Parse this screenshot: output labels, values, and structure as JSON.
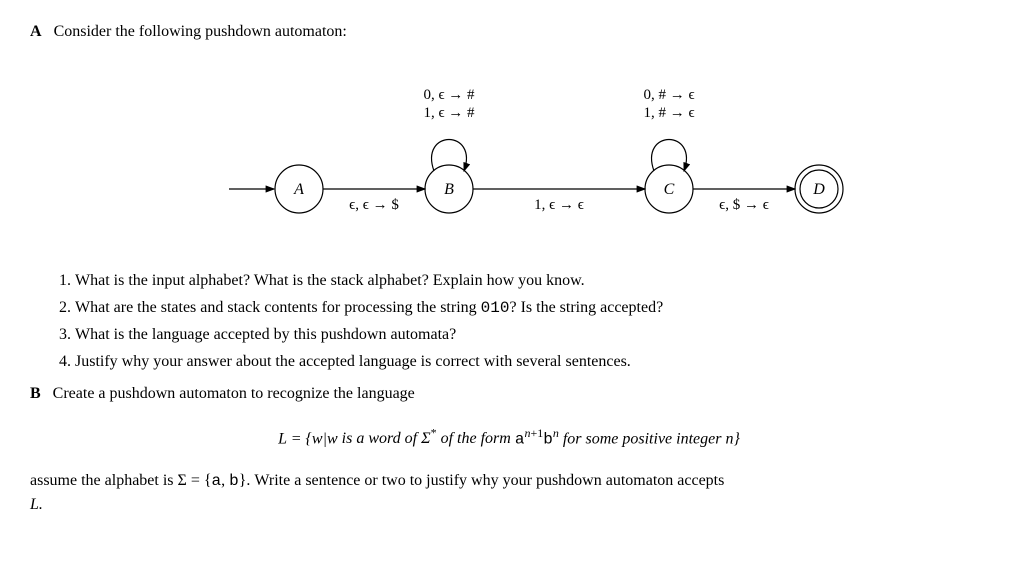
{
  "partA": {
    "label": "A",
    "intro": "Consider the following pushdown automaton:",
    "automaton": {
      "states": {
        "A": "A",
        "B": "B",
        "C": "C",
        "D": "D"
      },
      "transitions": {
        "A_to_B": "ϵ, ϵ → $",
        "B_loop_1": "0, ϵ → #",
        "B_loop_2": "1, ϵ → #",
        "B_to_C": "1, ϵ → ϵ",
        "C_loop_1": "0, # → ϵ",
        "C_loop_2": "1, # → ϵ",
        "C_to_D": "ϵ, $ → ϵ"
      }
    },
    "questions": [
      "What is the input alphabet? What is the stack alphabet? Explain how you know.",
      "What are the states and stack contents for processing the string 010? Is the string accepted?",
      "What is the language accepted by this pushdown automata?",
      "Justify why your answer about the accepted language is correct with several sentences."
    ]
  },
  "partB": {
    "label": "B",
    "intro": "Create a pushdown automaton to recognize the language",
    "language_prefix": "L = {w|w",
    "language_mid1": " is a word of Σ",
    "language_star": "*",
    "language_mid2": " of the form ",
    "language_a": "a",
    "language_exp1_pre": "n",
    "language_exp1_plus": "+1",
    "language_b": "b",
    "language_exp2": "n",
    "language_suffix": " for some positive integer n}",
    "closing_1": "assume the alphabet is Σ = {",
    "closing_a": "a",
    "closing_comma": ", ",
    "closing_b": "b",
    "closing_2": "}. Write a sentence or two to justify why your pushdown automaton accepts",
    "closing_3": "L."
  }
}
